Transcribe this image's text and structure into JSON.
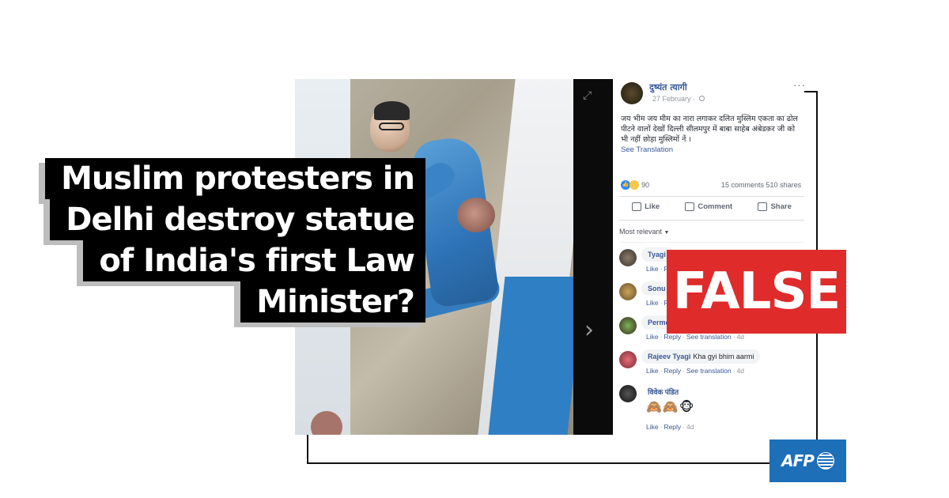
{
  "headline": {
    "lines": [
      "Muslim protesters in",
      "Delhi destroy statue",
      "of India's first Law",
      "Minister?"
    ]
  },
  "verdict": {
    "label": "FALSE",
    "color": "#e02b2b"
  },
  "brand": {
    "logo_text": "AFP",
    "color": "#1d6fb8"
  },
  "post": {
    "author": "दुष्यंत त्यागी",
    "date": "27 February",
    "text": "जय भीम जय मीम का नारा लगाकर दलित मुस्लिम एकता का ढोल पीटने वालों देखों दिल्ली सीलमपुर में बाबा साहेब अंबेडकर जी को भी नहीं छोड़ा मुस्लिमों नें ।",
    "see_translation": "See Translation",
    "reaction_count": "90",
    "comments_count": "15 comments",
    "shares_count": "510 shares",
    "actions": {
      "like": "Like",
      "comment": "Comment",
      "share": "Share"
    },
    "sort_label": "Most relevant"
  },
  "comments": [
    {
      "name": "Tyagi",
      "text": "",
      "meta": [
        "Like",
        "R"
      ],
      "time": ""
    },
    {
      "name": "Sonu",
      "text": "",
      "meta": [
        "Like",
        "R"
      ],
      "time": ""
    },
    {
      "name": "Permo",
      "text": "",
      "meta": [
        "Like",
        "Reply",
        "See translation"
      ],
      "time": "4d"
    },
    {
      "name": "Rajeev Tyagi",
      "text": "Kha gyi bhim aarmi",
      "meta": [
        "Like",
        "Reply",
        "See translation"
      ],
      "time": "4d"
    },
    {
      "name": "विवेक पंडित",
      "text": "🙈🙈🐵",
      "meta": [
        "Like",
        "Reply"
      ],
      "time": "4d"
    }
  ]
}
